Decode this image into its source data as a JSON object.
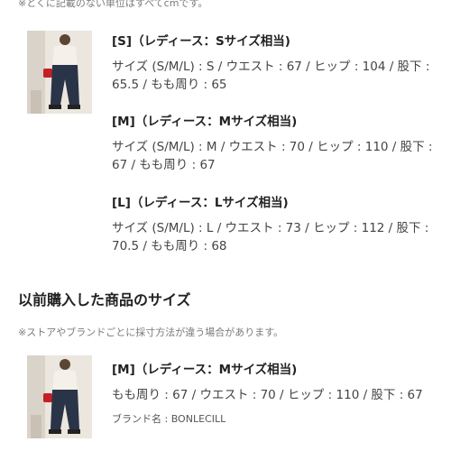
{
  "unit_note": "※とくに記載のない単位はすべてcmです。",
  "sizes": [
    {
      "title": "[S]（レディース：Sサイズ相当)",
      "desc": "サイズ (S/M/L) : S / ウエスト : 67 / ヒップ : 104 / 股下 : 65.5 / もも周り : 65"
    },
    {
      "title": "[M]（レディース：Mサイズ相当)",
      "desc": "サイズ (S/M/L) : M / ウエスト : 70 / ヒップ : 110 / 股下 : 67 / もも周り : 67"
    },
    {
      "title": "[L]（レディース：Lサイズ相当)",
      "desc": "サイズ (S/M/L) : L / ウエスト : 73 / ヒップ : 112 / 股下 : 70.5 / もも周り : 68"
    }
  ],
  "previous": {
    "title": "以前購入した商品のサイズ",
    "note": "※ストアやブランドごとに採寸方法が違う場合があります。",
    "item": {
      "title": "[M]（レディース：Mサイズ相当)",
      "desc": "もも周り : 67 / ウエスト : 70 / ヒップ : 110 / 股下 : 67",
      "brand": "ブランド名 : BONLECILL"
    }
  }
}
